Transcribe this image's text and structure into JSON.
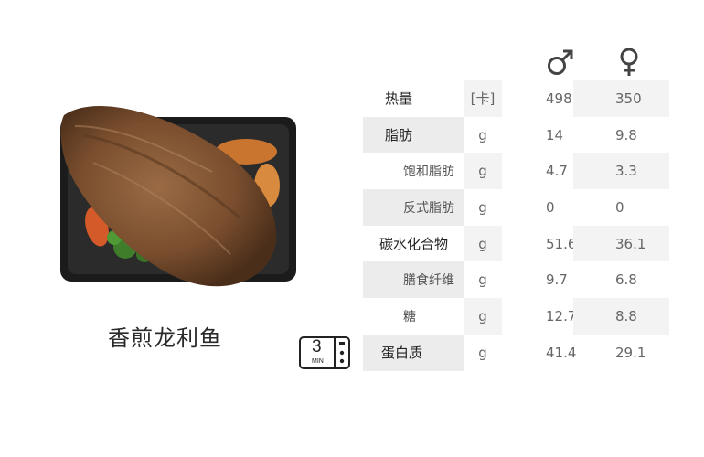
{
  "dish": {
    "name": "香煎龙利鱼"
  },
  "microwave": {
    "number": "3",
    "unit": "MIN"
  },
  "columns": {
    "male_icon": "male-symbol",
    "female_icon": "female-symbol"
  },
  "nutrition": [
    {
      "name": "热量",
      "unit": "[卡]",
      "male": "498",
      "female": "350",
      "style": "main"
    },
    {
      "name": "脂肪",
      "unit": "g",
      "male": "14",
      "female": "9.8",
      "style": "main"
    },
    {
      "name": "饱和脂肪",
      "unit": "g",
      "male": "4.7",
      "female": "3.3",
      "style": "sub"
    },
    {
      "name": "反式脂肪",
      "unit": "g",
      "male": "0",
      "female": "0",
      "style": "sub"
    },
    {
      "name": "碳水化合物",
      "unit": "g",
      "male": "51.6",
      "female": "36.1",
      "style": "main"
    },
    {
      "name": "膳食纤维",
      "unit": "g",
      "male": "9.7",
      "female": "6.8",
      "style": "sub"
    },
    {
      "name": "糖",
      "unit": "g",
      "male": "12.7",
      "female": "8.8",
      "style": "sub"
    },
    {
      "name": "蛋白质",
      "unit": "g",
      "male": "41.4",
      "female": "29.1",
      "style": "main"
    }
  ]
}
